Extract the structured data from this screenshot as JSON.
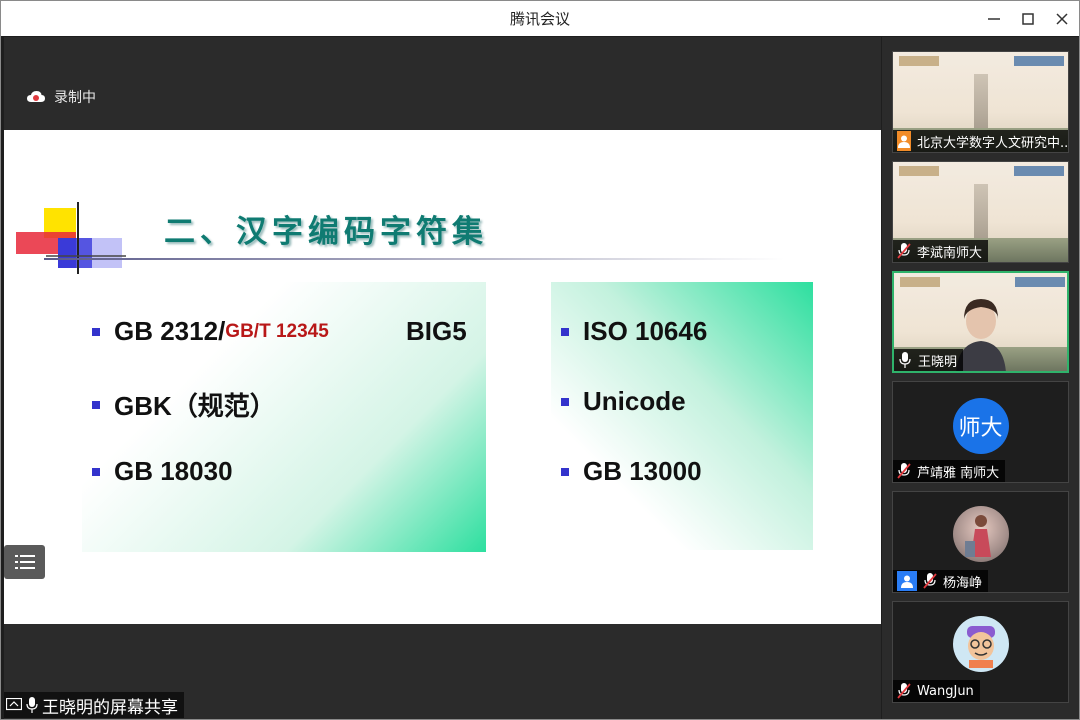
{
  "window": {
    "title": "腾讯会议"
  },
  "recording": {
    "label": "录制中"
  },
  "slide": {
    "title": "二、汉字编码字符集",
    "left_items": [
      {
        "main": "GB 2312/",
        "sub": "GB/T 12345"
      },
      {
        "main": "GBK（规范）"
      },
      {
        "main": "GB 18030"
      }
    ],
    "extra_item": "BIG5",
    "right_items": [
      "ISO 10646",
      "Unicode",
      "GB 13000"
    ],
    "colors": {
      "title": "#0f7b72",
      "bullet": "#3333cc",
      "subtext": "#b81818",
      "accent_green": "#2ddf9f"
    }
  },
  "share": {
    "label": "王晓明的屏幕共享"
  },
  "participants": [
    {
      "name": "北京大学数字人文研究中...",
      "view": "slide-thumbnail",
      "icon": "orange-person-icon"
    },
    {
      "name": "李斌南师大",
      "view": "slide-thumbnail",
      "icon": "mic-muted-icon"
    },
    {
      "name": "王晓明",
      "view": "camera",
      "icon": "mic-icon",
      "speaking": true
    },
    {
      "name": "芦靖雅 南师大",
      "view": "avatar-text",
      "avatar_text": "师大",
      "icon": "mic-muted-icon"
    },
    {
      "name": "杨海峥",
      "view": "avatar-photo",
      "icon": "mic-muted-icon"
    },
    {
      "name": "WangJun",
      "view": "avatar-cartoon",
      "icon": "mic-muted-icon"
    }
  ]
}
